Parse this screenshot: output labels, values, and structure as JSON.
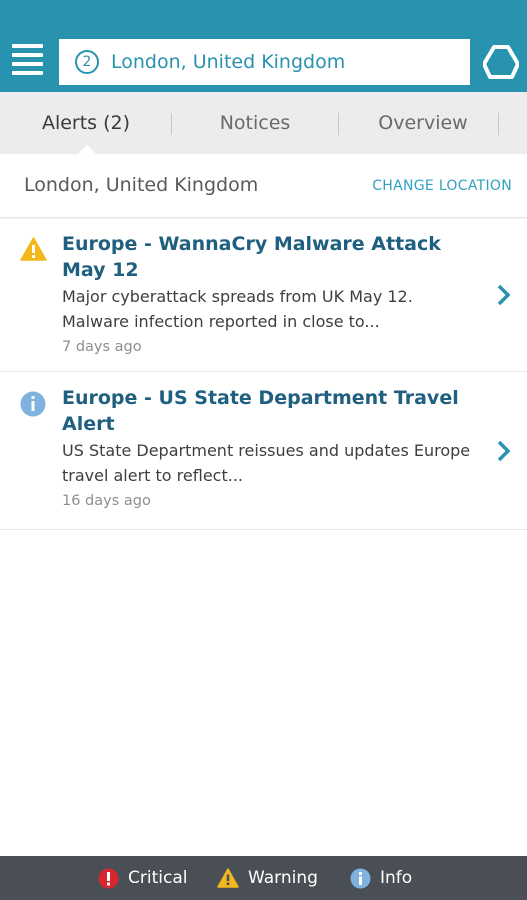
{
  "header": {
    "alert_count": "2",
    "search_value": "London, United Kingdom",
    "colors": {
      "brand": "#2793ae"
    }
  },
  "tabs": [
    {
      "label": "Alerts (2)",
      "active": true
    },
    {
      "label": "Notices",
      "active": false
    },
    {
      "label": "Overview",
      "active": false
    }
  ],
  "location": {
    "name": "London, United Kingdom",
    "change_label": "CHANGE LOCATION"
  },
  "alerts": [
    {
      "severity": "warning",
      "icon": "warning-icon",
      "title": "Europe - WannaCry Malware Attack May 12",
      "summary": "Major cyberattack spreads from UK May 12. Malware infection reported in close to...",
      "time": "7 days ago"
    },
    {
      "severity": "info",
      "icon": "info-icon",
      "title": "Europe - US State Department Travel Alert",
      "summary": "US State Department reissues and updates Europe travel alert to reflect...",
      "time": "16 days ago"
    }
  ],
  "legend": {
    "critical": "Critical",
    "warning": "Warning",
    "info": "Info",
    "colors": {
      "critical": "#d8262d",
      "warning": "#f2b81c",
      "info": "#7fb2de"
    }
  }
}
